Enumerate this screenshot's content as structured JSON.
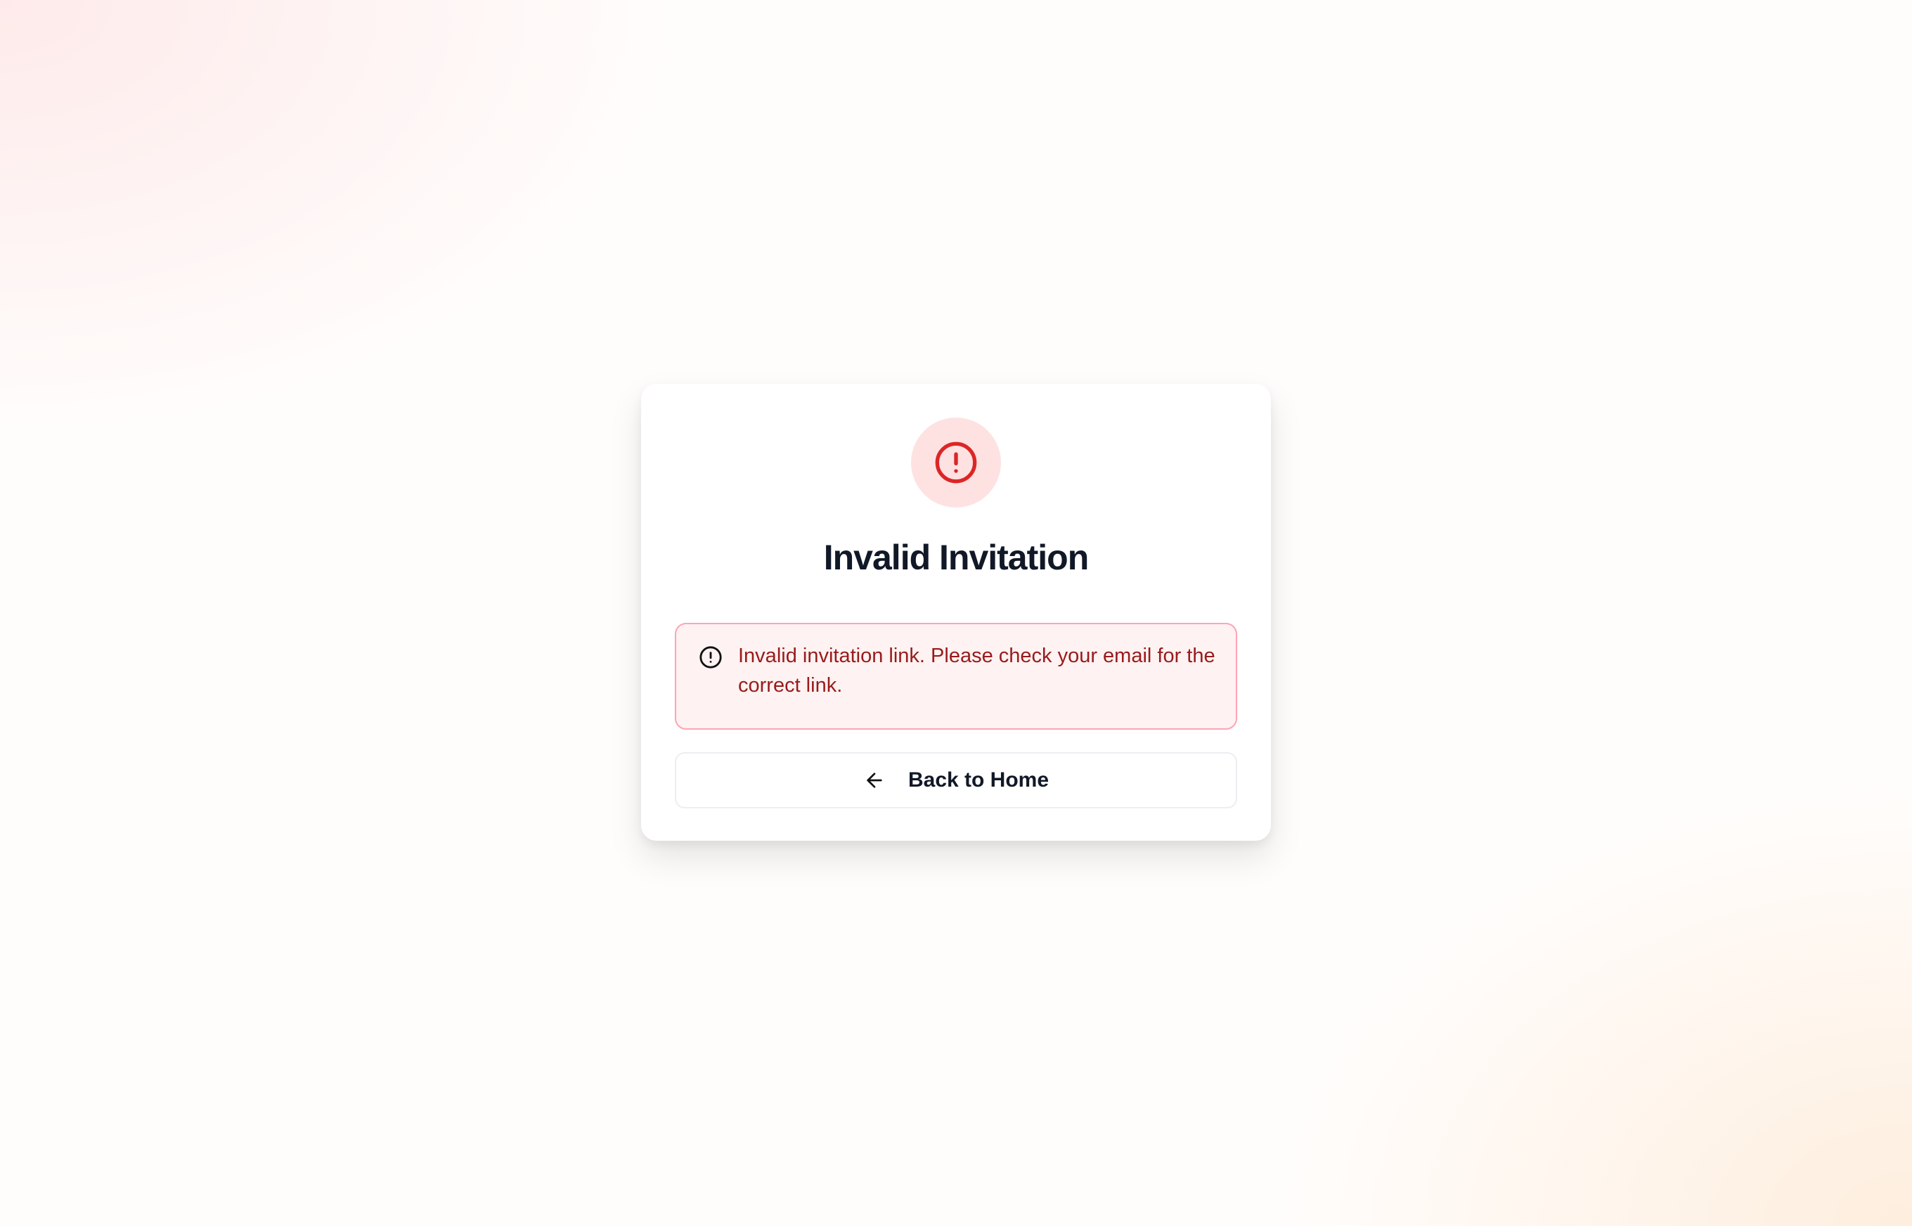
{
  "card": {
    "title": "Invalid Invitation",
    "status_icon": "alert-circle-icon"
  },
  "alert": {
    "icon": "alert-circle-icon",
    "message": "Invalid invitation link. Please check your email for the correct link."
  },
  "actions": {
    "back_icon": "arrow-left-icon",
    "back_label": "Back to Home"
  },
  "colors": {
    "error_red": "#dc2626",
    "error_text": "#991b1b",
    "error_bg": "#fef2f2",
    "error_border": "#fca5b5",
    "icon_badge_bg": "#fee2e2",
    "heading": "#111827"
  }
}
